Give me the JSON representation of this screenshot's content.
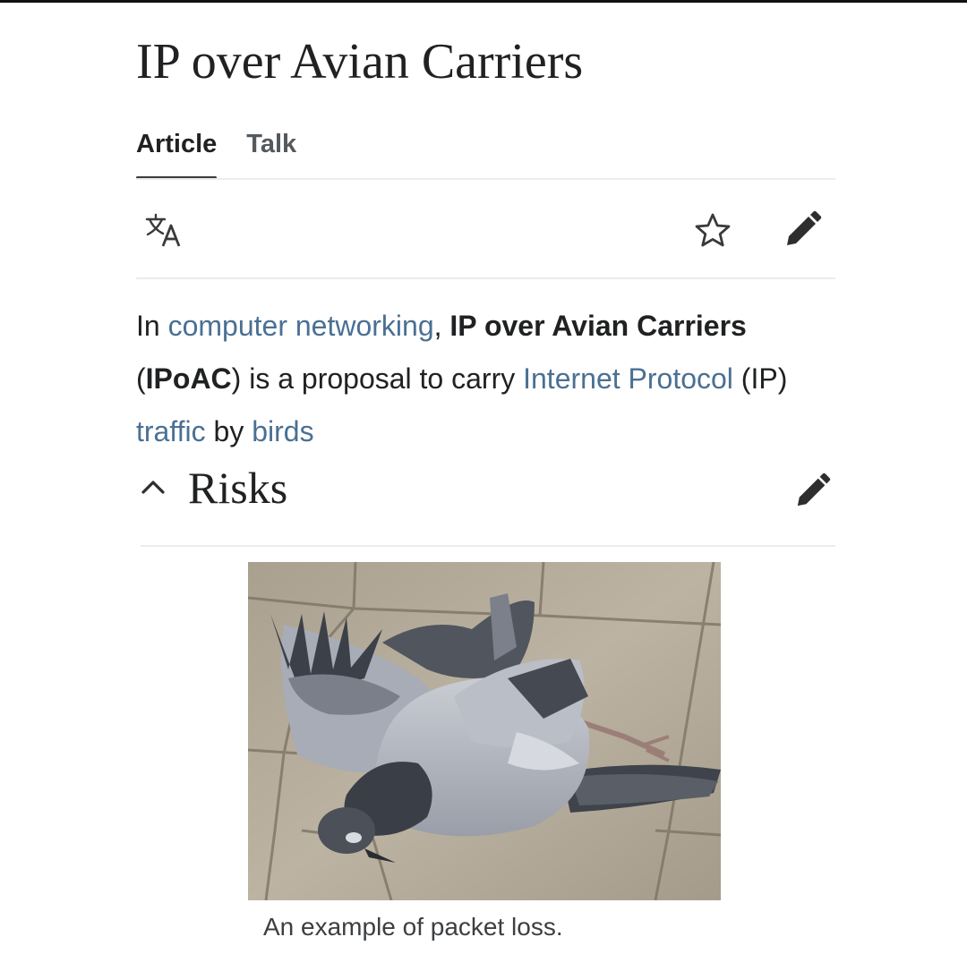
{
  "article": {
    "title": "IP over Avian Carriers",
    "tabs": [
      {
        "label": "Article",
        "selected": true
      },
      {
        "label": "Talk",
        "selected": false
      }
    ]
  },
  "toolbar": {
    "icons": [
      "language-icon",
      "star-icon",
      "edit-pencil-icon"
    ]
  },
  "intro": {
    "t1": "In ",
    "link_computer_networking": "computer networking",
    "t2": ", ",
    "bold_title": "IP over Avian Carriers",
    "t3": " (",
    "bold_abbrev": "IPoAC",
    "t4": ") is a proposal to carry ",
    "link_internet_protocol": "Internet Protocol",
    "t5": " (IP) ",
    "link_traffic": "traffic",
    "t6": " by ",
    "link_birds": "birds"
  },
  "section": {
    "title": "Risks",
    "expanded": true,
    "icons": [
      "chevron-up-icon",
      "edit-pencil-icon"
    ]
  },
  "figure": {
    "caption": "An example of packet loss."
  },
  "colors": {
    "link": "#4a7093",
    "text": "#202122",
    "divider": "#eaecf0"
  }
}
